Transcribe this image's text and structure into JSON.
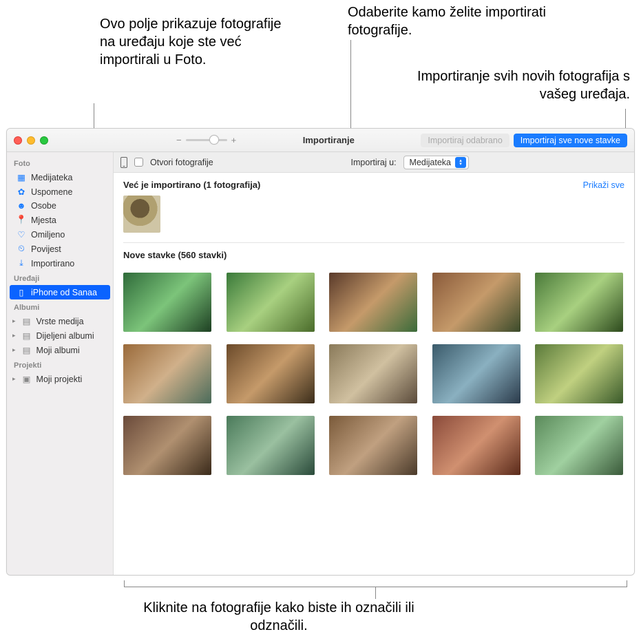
{
  "annotations": {
    "already": "Ovo polje prikazuje fotografije na uređaju koje ste već importirali u Foto.",
    "destination": "Odaberite kamo želite importirati fotografije.",
    "importAll": "Importiranje svih novih fotografija s vašeg uređaja.",
    "clickSelect": "Kliknite na fotografije kako biste ih označili ili odznačili."
  },
  "titlebar": {
    "zoom_minus": "−",
    "zoom_plus": "+",
    "title": "Importiranje",
    "import_selected": "Importiraj odabrano",
    "import_all_new": "Importiraj sve nove stavke"
  },
  "toolbar": {
    "open_photos": "Otvori fotografije",
    "import_to_label": "Importiraj u:",
    "import_to_value": "Medijateka"
  },
  "sidebar": {
    "section_foto": "Foto",
    "items_foto": [
      {
        "icon": "photos",
        "label": "Medijateka"
      },
      {
        "icon": "memories",
        "label": "Uspomene"
      },
      {
        "icon": "people",
        "label": "Osobe"
      },
      {
        "icon": "places",
        "label": "Mjesta"
      },
      {
        "icon": "fav",
        "label": "Omiljeno"
      },
      {
        "icon": "recent",
        "label": "Povijest"
      },
      {
        "icon": "import",
        "label": "Importirano"
      }
    ],
    "section_devices": "Uređaji",
    "device": {
      "icon": "phone",
      "label": "iPhone od Sanaa"
    },
    "section_albums": "Albumi",
    "items_albums": [
      {
        "label": "Vrste medija"
      },
      {
        "label": "Dijeljeni albumi"
      },
      {
        "label": "Moji albumi"
      }
    ],
    "section_projects": "Projekti",
    "items_projects": [
      {
        "label": "Moji projekti"
      }
    ]
  },
  "sections": {
    "already_header": "Već je importirano (1 fotografija)",
    "show_all": "Prikaži sve",
    "new_header": "Nove stavke (560 stavki)"
  }
}
